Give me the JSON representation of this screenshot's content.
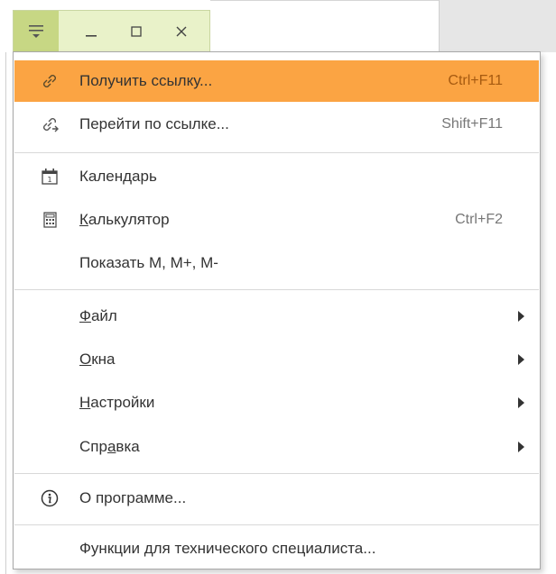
{
  "titlebar": {
    "menu_icon": "hamburger-dropdown-icon",
    "minimize_icon": "minimize-icon",
    "maximize_icon": "maximize-icon",
    "close_icon": "close-icon"
  },
  "menu": {
    "items": [
      {
        "label": "Получить ссылку...",
        "shortcut": "Ctrl+F11",
        "icon": "link-icon",
        "active": true
      },
      {
        "label": "Перейти по ссылке...",
        "shortcut": "Shift+F11",
        "icon": "goto-link-icon"
      },
      {
        "label": "Календарь",
        "shortcut": "",
        "icon": "calendar-icon"
      },
      {
        "label_pre": "",
        "label_ul": "К",
        "label_post": "алькулятор",
        "shortcut": "Ctrl+F2",
        "icon": "calculator-icon"
      },
      {
        "label": "Показать M, M+, M-",
        "shortcut": ""
      },
      {
        "label_pre": "",
        "label_ul": "Ф",
        "label_post": "айл",
        "submenu": true
      },
      {
        "label_pre": "",
        "label_ul": "О",
        "label_post": "кна",
        "submenu": true
      },
      {
        "label_pre": "",
        "label_ul": "Н",
        "label_post": "астройки",
        "submenu": true
      },
      {
        "label_pre": "Спр",
        "label_ul": "а",
        "label_post": "вка",
        "submenu": true
      },
      {
        "label": "О программе...",
        "shortcut": "",
        "icon": "info-icon"
      },
      {
        "label": "Функции для технического специалиста...",
        "shortcut": ""
      }
    ]
  },
  "colors": {
    "active_item": "#fba443",
    "titlebar_bg": "#e9f2c9",
    "menu_button_bg": "#c7d784",
    "separator": "#d8d8d8"
  }
}
